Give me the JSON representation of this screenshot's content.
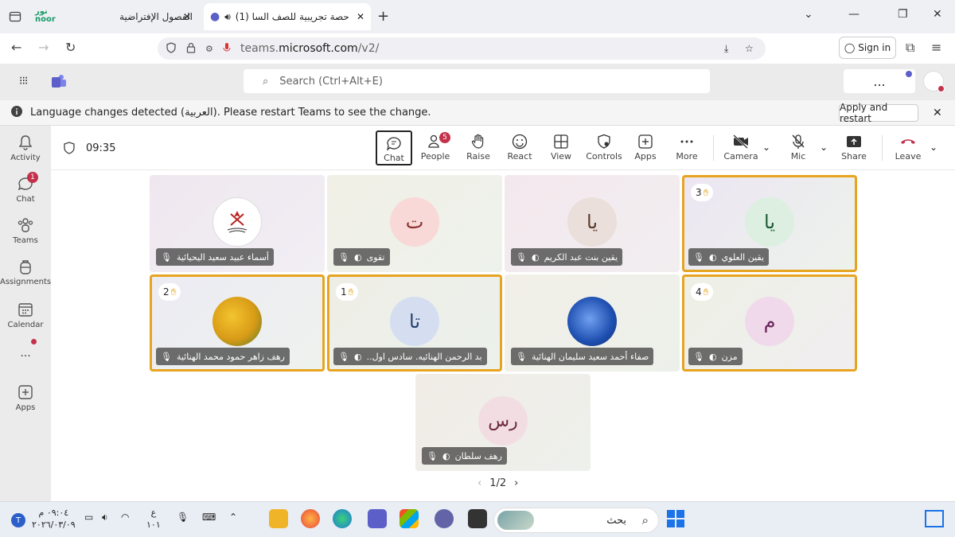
{
  "browser": {
    "tab1_title": "الفصول الإفتراضية",
    "tab2_title": "(1) حصة تجريبية للصف السا",
    "noor_label": "noor",
    "url_prefix": "teams.",
    "url_domain": "microsoft.com",
    "url_path": "/v2/",
    "signin_label": "Sign in"
  },
  "teams": {
    "search_placeholder": "Search (Ctrl+Alt+E)",
    "more_label": "...",
    "banner_text": "Language changes detected (العربية). Please restart Teams to see the change.",
    "apply_label": "Apply and restart"
  },
  "rail": {
    "items": [
      {
        "label": "Activity"
      },
      {
        "label": "Chat",
        "badge": "1"
      },
      {
        "label": "Teams"
      },
      {
        "label": "Assignments"
      },
      {
        "label": "Calendar"
      },
      {
        "label": "..."
      },
      {
        "label": "Apps"
      }
    ]
  },
  "meeting": {
    "timer": "09:35",
    "toolbar": {
      "chat": "Chat",
      "people": "People",
      "people_badge": "5",
      "raise": "Raise",
      "react": "React",
      "view": "View",
      "controls": "Controls",
      "apps": "Apps",
      "more": "More",
      "camera": "Camera",
      "mic": "Mic",
      "share": "Share",
      "leave": "Leave"
    },
    "tiles": [
      {
        "name": "أسماء عبيد سعيد اليحيائية",
        "initials": "",
        "hand": ""
      },
      {
        "name": "تقوى",
        "initials": "ت",
        "hand": ""
      },
      {
        "name": "يقين بنت عبد الكريم",
        "initials": "يا",
        "hand": ""
      },
      {
        "name": "يقين العلوي",
        "initials": "يا",
        "hand": "3"
      },
      {
        "name": "رهف زاهر حمود محمد الهنائية",
        "initials": "",
        "hand": "2"
      },
      {
        "name": "..بد الرحمن الهنائيه. سادس اول",
        "initials": "تا",
        "hand": "1"
      },
      {
        "name": "صفاء أحمد سعيد سليمان الهنائية",
        "initials": "",
        "hand": ""
      },
      {
        "name": "مزن",
        "initials": "م",
        "hand": "4"
      },
      {
        "name": "رهف سلطان",
        "initials": "رس",
        "hand": ""
      }
    ],
    "pager": "1/2"
  },
  "taskbar": {
    "time": "٠٩:٠٤ م",
    "date": "٢٠٢٦/٠٣/٠٩",
    "lang": "ع",
    "lang2": "١٠١",
    "search_label": "بحث",
    "notif_badge": "T"
  },
  "colors": {
    "highlight": "#e7a420",
    "accent": "#5b5fc7",
    "leave": "#c4314b"
  }
}
